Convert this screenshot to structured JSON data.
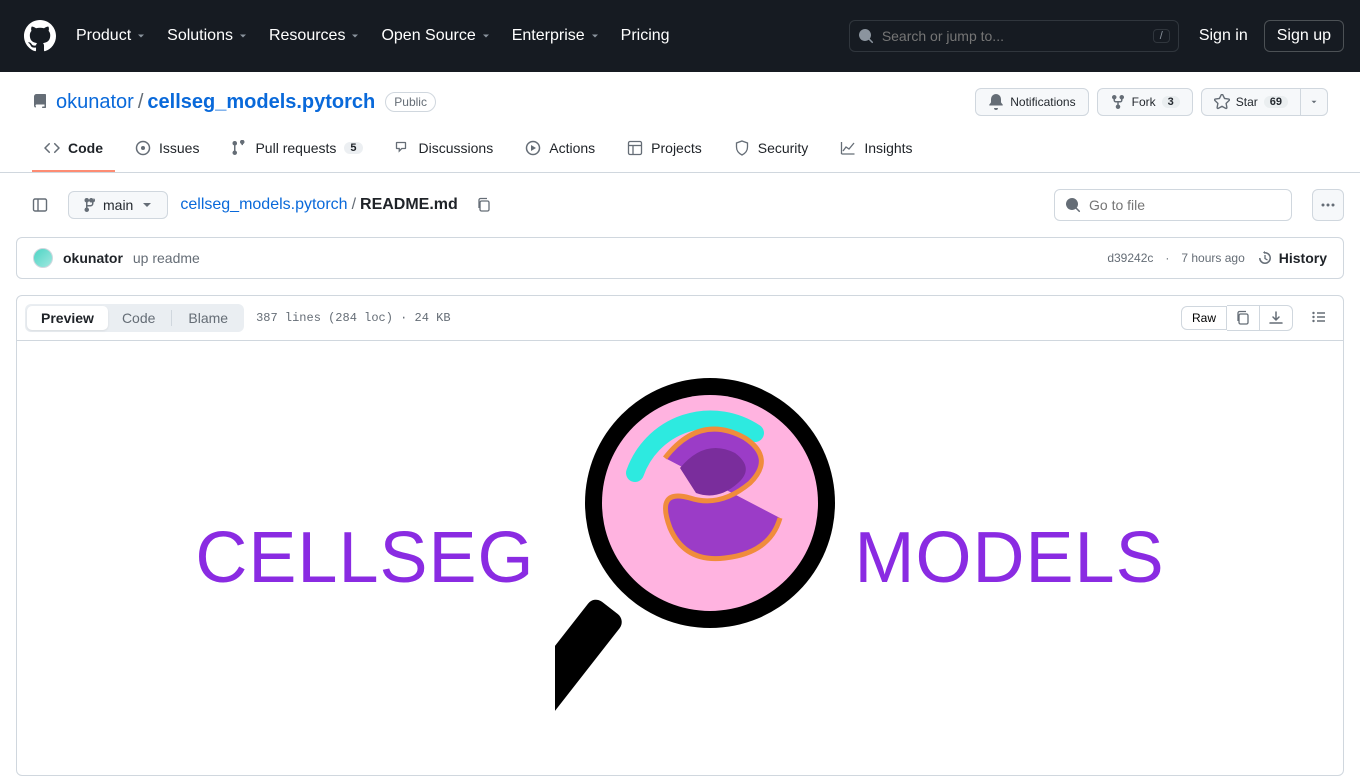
{
  "header": {
    "nav": [
      "Product",
      "Solutions",
      "Resources",
      "Open Source",
      "Enterprise",
      "Pricing"
    ],
    "nav_has_dropdown": [
      true,
      true,
      true,
      true,
      true,
      false
    ],
    "search_placeholder": "Search or jump to...",
    "slash": "/",
    "sign_in": "Sign in",
    "sign_up": "Sign up"
  },
  "repo": {
    "owner": "okunator",
    "name": "cellseg_models.pytorch",
    "visibility": "Public",
    "notifications": "Notifications",
    "fork": "Fork",
    "fork_count": "3",
    "star": "Star",
    "star_count": "69"
  },
  "tabs": [
    {
      "label": "Code",
      "count": null
    },
    {
      "label": "Issues",
      "count": null
    },
    {
      "label": "Pull requests",
      "count": "5"
    },
    {
      "label": "Discussions",
      "count": null
    },
    {
      "label": "Actions",
      "count": null
    },
    {
      "label": "Projects",
      "count": null
    },
    {
      "label": "Security",
      "count": null
    },
    {
      "label": "Insights",
      "count": null
    }
  ],
  "file_nav": {
    "branch": "main",
    "repo_link": "cellseg_models.pytorch",
    "file": "README.md",
    "go_to_file_placeholder": "Go to file"
  },
  "commit": {
    "author": "okunator",
    "message": "up readme",
    "sha": "d39242c",
    "time": "7 hours ago",
    "history": "History"
  },
  "file_toolbar": {
    "preview": "Preview",
    "code": "Code",
    "blame": "Blame",
    "meta": "387 lines (284 loc) · 24 KB",
    "raw": "Raw"
  },
  "readme": {
    "text_left": "CELLSEG",
    "text_right": "MODELS"
  }
}
